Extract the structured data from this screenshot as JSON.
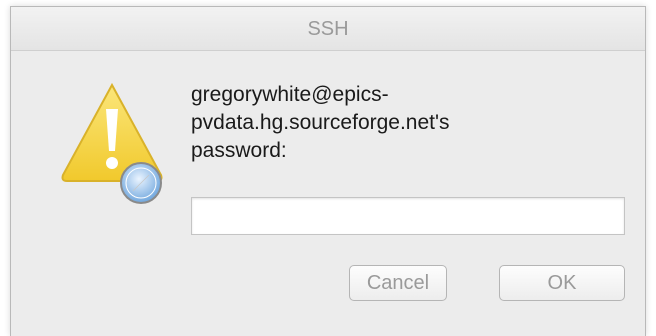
{
  "dialog": {
    "title": "SSH",
    "icon": "warning-safari-icon",
    "message_lines": [
      "gregorywhite@epics-",
      "pvdata.hg.sourceforge.net's",
      "password:"
    ],
    "password_value": "",
    "cancel_label": "Cancel",
    "ok_label": "OK"
  },
  "colors": {
    "warning_yellow": "#f5d43a",
    "title_text": "#9a9a9a",
    "window_bg": "#ececec"
  }
}
